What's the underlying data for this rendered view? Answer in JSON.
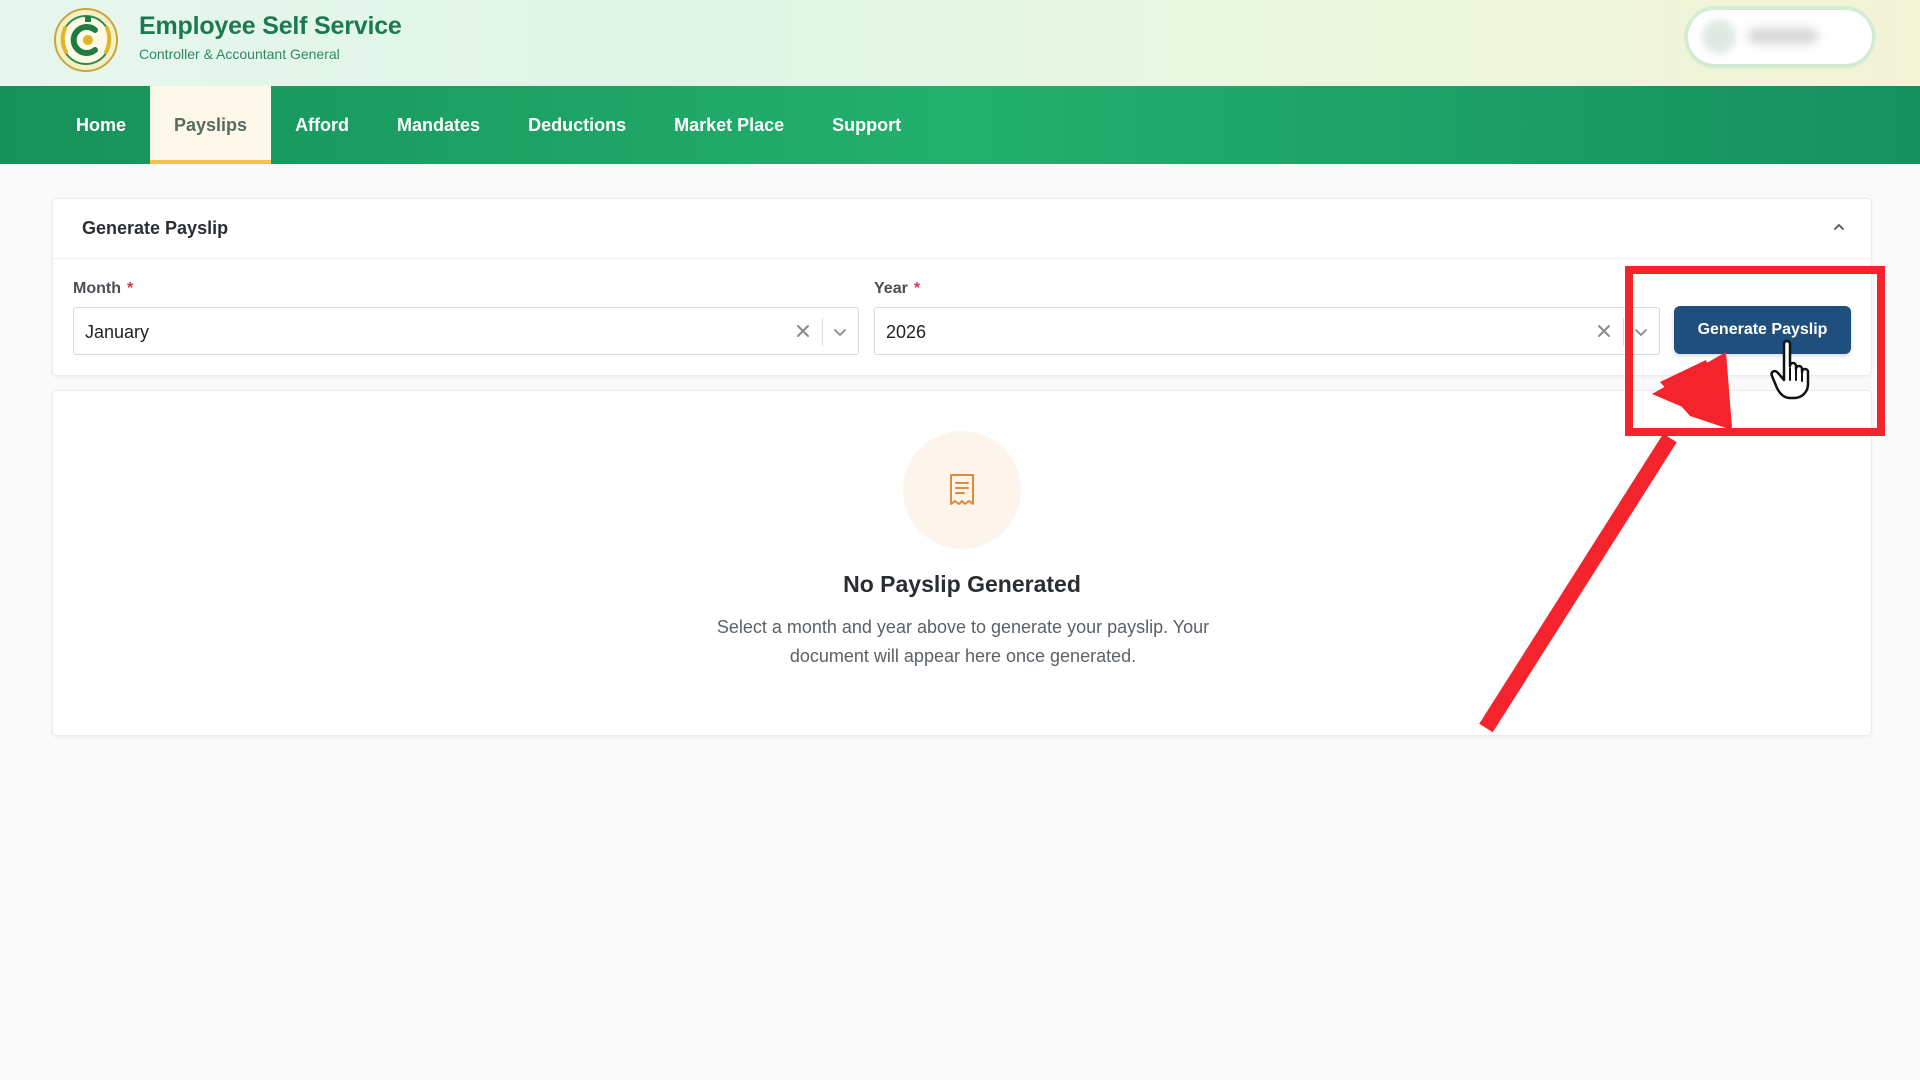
{
  "header": {
    "title": "Employee Self Service",
    "subtitle": "Controller & Accountant General"
  },
  "nav": {
    "items": [
      {
        "label": "Home",
        "active": false
      },
      {
        "label": "Payslips",
        "active": true
      },
      {
        "label": "Afford",
        "active": false
      },
      {
        "label": "Mandates",
        "active": false
      },
      {
        "label": "Deductions",
        "active": false
      },
      {
        "label": "Market Place",
        "active": false
      },
      {
        "label": "Support",
        "active": false
      }
    ]
  },
  "form": {
    "title": "Generate Payslip",
    "month_label": "Month",
    "month_value": "January",
    "year_label": "Year",
    "year_value": "2026",
    "required_mark": "*",
    "submit_label": "Generate Payslip"
  },
  "empty_state": {
    "title": "No Payslip Generated",
    "description": "Select a month and year above to generate your payslip. Your document will appear here once generated."
  },
  "colors": {
    "brand_green": "#1b7a4e",
    "nav_green": "#23b06d",
    "active_tab_accent": "#f3c34a",
    "button_blue": "#1f4f7d",
    "annotation_red": "#f4232c",
    "required_red": "#e0324b"
  },
  "icons": {
    "logo": "government-seal-logo",
    "collapse": "chevron-up-icon",
    "clear": "close-icon",
    "dropdown": "chevron-down-icon",
    "empty": "receipt-document-icon",
    "cursor": "hand-pointer-icon"
  }
}
